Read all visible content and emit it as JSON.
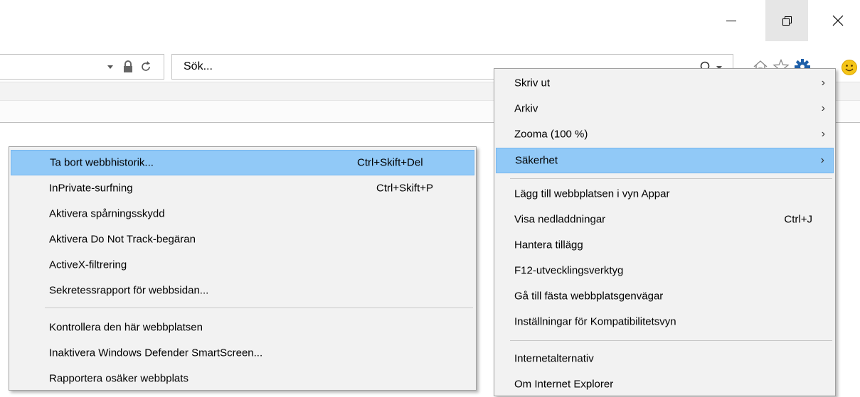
{
  "window": {
    "minimize_icon": "minimize-icon",
    "restore_icon": "restore-icon",
    "close_icon": "close-icon"
  },
  "address_bar": {
    "dropdown_icon": "chevron-down-icon",
    "lock_icon": "lock-icon",
    "refresh_icon": "refresh-icon"
  },
  "search": {
    "placeholder": "Sök...",
    "search_icon": "search-icon"
  },
  "toolbar": {
    "home_icon": "home-icon",
    "favorites_icon": "star-icon",
    "tools_icon": "gear-icon",
    "feedback_icon": "smiley-icon"
  },
  "tools_menu": {
    "items": [
      {
        "label": "Skriv ut",
        "arrow": "›"
      },
      {
        "label": "Arkiv",
        "arrow": "›"
      },
      {
        "label": "Zooma (100 %)",
        "arrow": "›"
      },
      {
        "label": "Säkerhet",
        "arrow": "›"
      },
      {
        "label": "Lägg till webbplatsen i vyn Appar"
      },
      {
        "label": "Visa nedladdningar",
        "shortcut": "Ctrl+J"
      },
      {
        "label": "Hantera tillägg"
      },
      {
        "label": "F12-utvecklingsverktyg"
      },
      {
        "label": "Gå till fästa webbplatsgenvägar"
      },
      {
        "label": "Inställningar för Kompatibilitetsvyn"
      },
      {
        "label": "Internetalternativ"
      },
      {
        "label": "Om Internet Explorer"
      }
    ]
  },
  "safety_menu": {
    "items": [
      {
        "label": "Ta bort webbhistorik...",
        "shortcut": "Ctrl+Skift+Del"
      },
      {
        "label": "InPrivate-surfning",
        "shortcut": "Ctrl+Skift+P"
      },
      {
        "label": "Aktivera spårningsskydd"
      },
      {
        "label": "Aktivera Do Not Track-begäran"
      },
      {
        "label": "ActiveX-filtrering"
      },
      {
        "label": "Sekretessrapport för webbsidan..."
      },
      {
        "label": "Kontrollera den här webbplatsen"
      },
      {
        "label": "Inaktivera Windows Defender SmartScreen..."
      },
      {
        "label": "Rapportera osäker webbplats"
      }
    ]
  },
  "colors": {
    "highlight": "#91c9f7",
    "menu_bg": "#f2f2f2",
    "gear_blue": "#1e5fa8",
    "smiley_yellow": "#f5c518"
  }
}
